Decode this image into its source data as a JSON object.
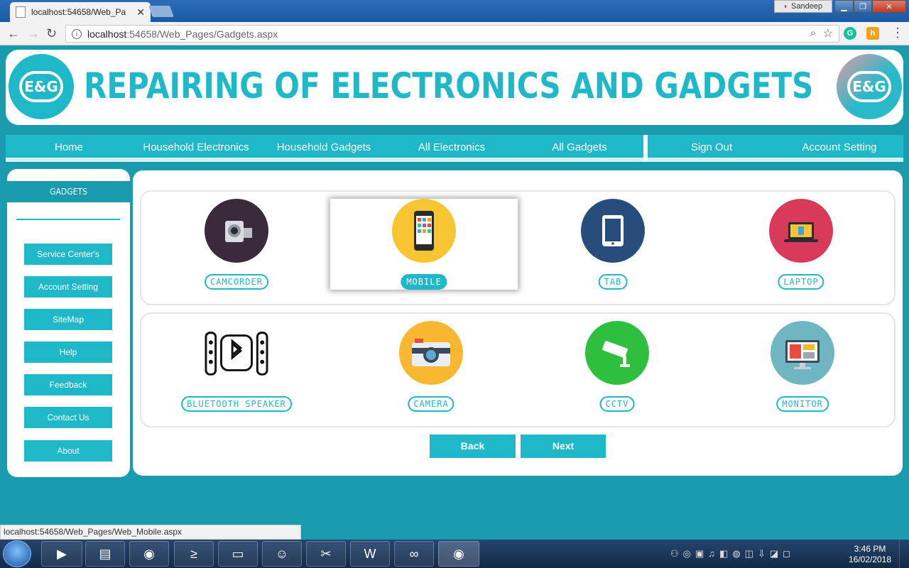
{
  "browser": {
    "tab_title": "localhost:54658/Web_Pa",
    "url_host": "localhost",
    "url_path": ":54658/Web_Pages/Gadgets.aspx",
    "user": "Sandeep",
    "status_url": "localhost:54658/Web_Pages/Web_Mobile.aspx"
  },
  "site": {
    "title": "REPAIRING OF  ELECTRONICS AND GADGETS",
    "logo_text": "E&G"
  },
  "nav": {
    "items": [
      "Home",
      "Household Electronics",
      "Household Gadgets",
      "All Electronics",
      "All Gadgets"
    ],
    "right_items": [
      "Sign Out",
      "Account Setting"
    ]
  },
  "sidebar": {
    "heading": "GADGETS",
    "items": [
      "Service Center's",
      "Account Setting",
      "SiteMap",
      "Help",
      "Feedback",
      "Contact Us",
      "About"
    ]
  },
  "gadgets": {
    "row1": [
      "CAMCORDER",
      "MOBILE",
      "TAB",
      "LAPTOP"
    ],
    "row2": [
      "BLUETOOTH SPEAKER",
      "CAMERA",
      "CCTV",
      "MONITOR"
    ],
    "selected": "MOBILE"
  },
  "pager": {
    "back": "Back",
    "next": "Next"
  },
  "taskbar": {
    "time": "3:46 PM",
    "date": "16/02/2018"
  },
  "colors": {
    "accent": "#1fb8c8",
    "background": "#1a9cae"
  }
}
